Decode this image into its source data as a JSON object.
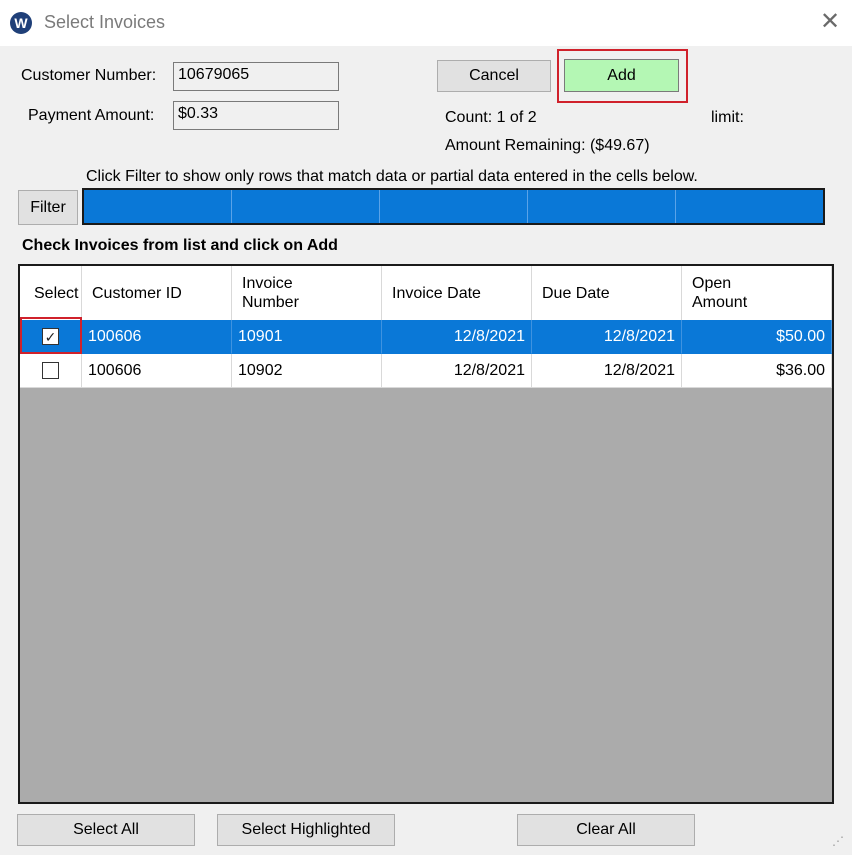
{
  "window": {
    "title": "Select Invoices",
    "icon_letter": "W"
  },
  "form": {
    "customer_number_label": "Customer Number:",
    "customer_number_value": "10679065",
    "payment_amount_label": "Payment Amount:",
    "payment_amount_value": "$0.33"
  },
  "buttons": {
    "cancel": "Cancel",
    "add": "Add",
    "filter": "Filter",
    "select_all": "Select All",
    "select_highlighted": "Select Highlighted",
    "clear_all": "Clear All"
  },
  "status": {
    "count": "Count: 1 of 2",
    "limit": "limit:",
    "amount_remaining": "Amount Remaining: ($49.67)"
  },
  "filter_hint": "Click Filter to show only rows that match data or partial data entered in the cells below.",
  "grid_caption": "Check Invoices from list and click on Add",
  "columns": [
    "Select",
    "Customer ID",
    "Invoice\nNumber",
    "Invoice Date",
    "Due Date",
    "Open\nAmount"
  ],
  "rows": [
    {
      "checked": true,
      "customer_id": "100606",
      "invoice_number": "10901",
      "invoice_date": "12/8/2021",
      "due_date": "12/8/2021",
      "open_amount": "$50.00",
      "selected": true
    },
    {
      "checked": false,
      "customer_id": "100606",
      "invoice_number": "10902",
      "invoice_date": "12/8/2021",
      "due_date": "12/8/2021",
      "open_amount": "$36.00",
      "selected": false
    }
  ],
  "colors": {
    "accent": "#0a78d7",
    "add_button": "#b4f7b4",
    "highlight": "#d0212b"
  }
}
